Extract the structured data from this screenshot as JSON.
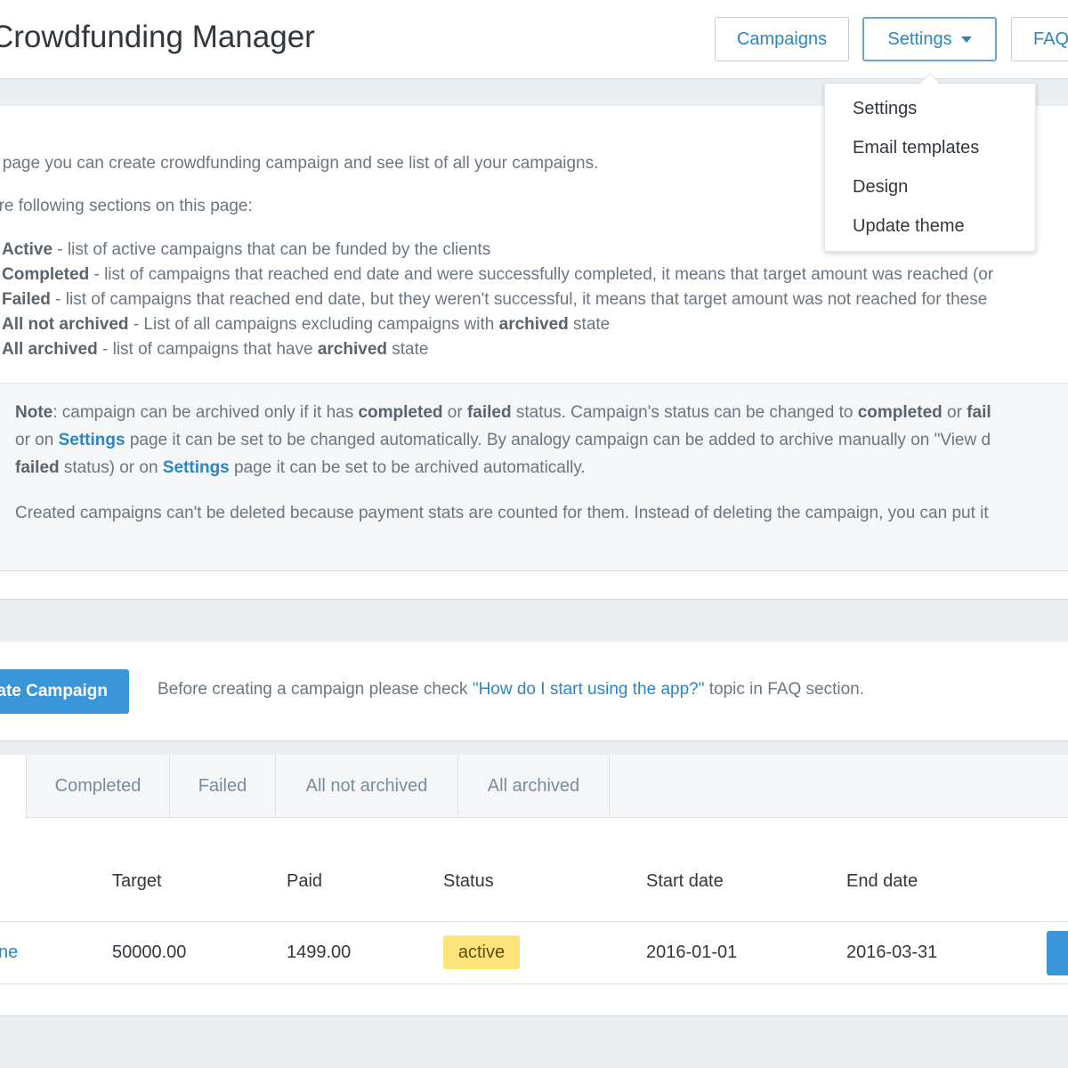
{
  "header": {
    "title": "Crowdfunding Manager",
    "nav": {
      "campaigns": "Campaigns",
      "settings": "Settings",
      "faq": "FAQ"
    }
  },
  "settings_menu": {
    "items": [
      "Settings",
      "Email templates",
      "Design",
      "Update theme"
    ]
  },
  "info": {
    "intro": "s page you can create crowdfunding campaign and see list of all your campaigns.",
    "sections_intro": "are following sections on this page:",
    "sections": [
      {
        "name": "Active",
        "desc": " - list of active campaigns that can be funded by the clients"
      },
      {
        "name": "Completed",
        "desc": " - list of campaigns that reached end date and were successfully completed, it means that target amount was reached (or"
      },
      {
        "name": "Failed",
        "desc": " - list of campaigns that reached end date, but they weren't successful, it means that target amount was not reached for these"
      },
      {
        "name": "All not archived",
        "desc": " - List of all campaigns excluding campaigns with ",
        "strong": "archived",
        "tail": " state"
      },
      {
        "name": "All archived",
        "desc": " - list of campaigns that have ",
        "strong": "archived",
        "tail": " state"
      }
    ],
    "note": {
      "label": "Note",
      "line1_a": ": campaign can be archived only if it has ",
      "completed": "completed",
      "or": " or ",
      "failed": "failed",
      "line1_b": " status. Campaign's status can be changed to ",
      "completed2": "completed",
      "or2": " or ",
      "fail_cut": "fail",
      "line2_a": "or on ",
      "settings_link": "Settings",
      "line2_b": " page it can be set to be changed automatically. By analogy campaign can be added to archive manually on \"View d",
      "failed2": "failed",
      "line3_a": " status) or on ",
      "settings_link2": "Settings",
      "line3_b": " page it can be set to be archived automatically.",
      "line4": "Created campaigns can't be deleted because payment stats are counted for them. Instead of deleting the campaign, you can put it"
    }
  },
  "create": {
    "button": "ate Campaign",
    "hint_before": "Before creating a campaign please check ",
    "hint_link": "\"How do I start using the app?\"",
    "hint_after": " topic in FAQ section."
  },
  "tabs": [
    "Completed",
    "Failed",
    "All not archived",
    "All archived"
  ],
  "table": {
    "headers": {
      "target": "Target",
      "paid": "Paid",
      "status": "Status",
      "start": "Start date",
      "end": "End date"
    },
    "rows": [
      {
        "name": "ne",
        "target": "50000.00",
        "paid": "1499.00",
        "status": "active",
        "start": "2016-01-01",
        "end": "2016-03-31"
      }
    ]
  },
  "colors": {
    "accent": "#2a86c4",
    "primary_button": "#3a96d8",
    "status_active": "#ffe37b"
  }
}
